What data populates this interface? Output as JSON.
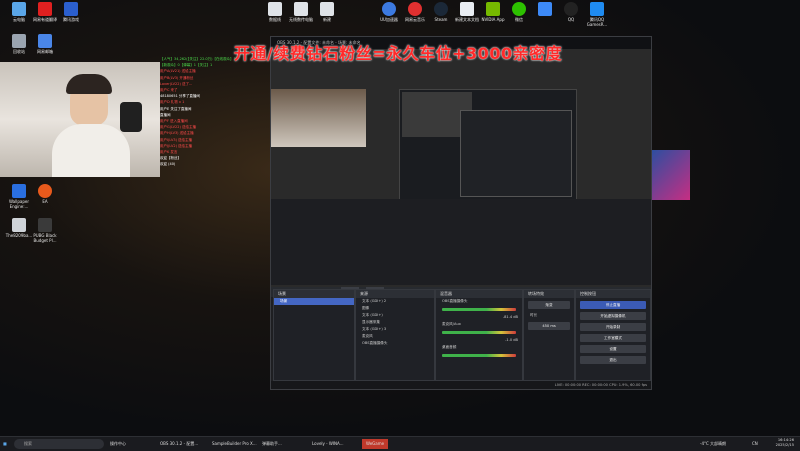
{
  "desktop": {
    "icons_top": [
      "云电脑",
      "网易有道翻译",
      "腾讯游戏",
      "",
      "",
      "",
      "",
      "",
      "",
      "",
      "",
      "",
      "",
      "",
      "",
      "",
      "",
      "",
      "",
      "",
      "",
      "",
      ""
    ],
    "icons_mid": [
      "回收站",
      "网易邮箱"
    ],
    "icons_left2": [
      "Wallpaper Engine:...",
      "EA",
      "The8209ba...",
      "PUBG Black Budget Pl..."
    ],
    "top_labels": [
      "数据线",
      "无线数传电脑",
      "新建",
      "UU加速器",
      "网易云音乐",
      "Steam",
      "新建文本文档",
      "NVIDIA App",
      "微信",
      "",
      "QQ",
      "腾讯QQ\nGamesR..."
    ]
  },
  "chat": {
    "lines": [
      "【人气】34,262(【关注】22.0万)【在线观众】10",
      "【新观众】0【弹幕】1【关注】1",
      "用户A(LV21) 送给主播",
      "用户B(LV3) 开通粉丝",
      "Lover(LV22) 送了...",
      "用户C 来了",
      "48180651 分享了直播间",
      "用户D 礼物 x 1",
      "用户E 关注了直播间",
      "直播间",
      "用户F 进入直播间",
      "用户G(LV22) 送给主播",
      "用户H(LV3) 送给主播",
      "用户I(LV3) 送给主播",
      "用户J(LV2) 送给主播",
      "用户K 发言",
      "欢迎【粉丝】",
      "欢迎 (40)"
    ]
  },
  "banner": "开通/续费钻石粉丝=永久车位+3000亲密度",
  "obs": {
    "title": "OBS 30.1.2 - 配置文件: 未命名 - 场景: 未命名",
    "toolbar": [
      "未选择源",
      "属性",
      "滤镜"
    ],
    "scenes": {
      "title": "场景",
      "items": [
        "场景"
      ]
    },
    "sources": {
      "title": "来源",
      "items": [
        "文本 (GDI+) 2",
        "图像",
        "文本 (GDI+)",
        "显示器采集",
        "文本 (GDI+) 3",
        "麦克风",
        "OBS直播摄像头"
      ]
    },
    "mixer": {
      "title": "混音器",
      "tracks": [
        {
          "name": "OBS直播摄像头",
          "db": "-81.4 dB",
          "level": 0.55
        },
        {
          "name": "麦克风/Aux",
          "db": "-1.0 dB",
          "level": 0.8
        },
        {
          "name": "桌面音频",
          "db": "-1.6 dB",
          "level": 0.75
        }
      ]
    },
    "transitions": {
      "title": "转场特效",
      "type": "渐变",
      "duration_label": "时长",
      "duration": "450 ms"
    },
    "controls": {
      "title": "控制按钮",
      "buttons": [
        "停止直播",
        "开始虚拟摄像机",
        "开始录制",
        "工作室模式",
        "设置",
        "退出"
      ]
    },
    "status": "LIVE: 00:00:00    REC: 00:00:00    CPU: 1.9%, 60.00 fps"
  },
  "taskbar": {
    "search_placeholder": "搜索",
    "apps": [
      "操作中心",
      "OBS 30.1.2 - 配置...",
      "SampleBuilder Pro X...",
      "弹幕助手...",
      "Lovely - WINA...",
      "WeGame"
    ],
    "tray": [
      "-4°C 大部晴朗",
      "CN",
      "16:14:26",
      "2025/2/15"
    ]
  }
}
